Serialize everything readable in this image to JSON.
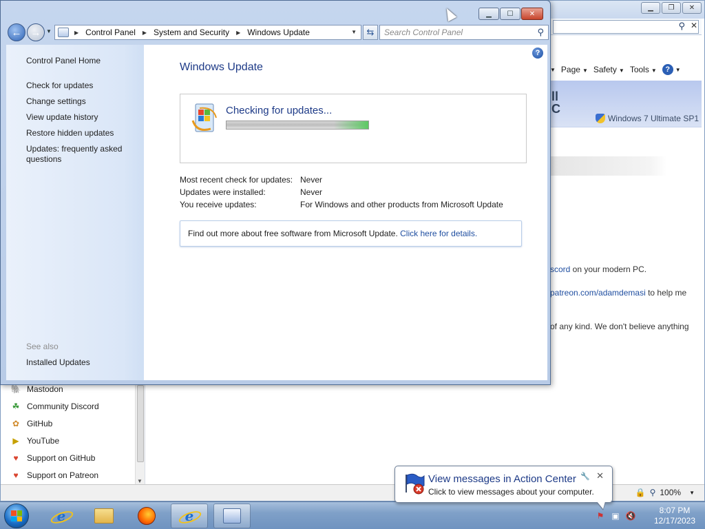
{
  "ie": {
    "page_menu": "Page",
    "safety_menu": "Safety",
    "tools_menu": "Tools",
    "banner_big": "ll\nC",
    "banner_edition": "Windows 7 Ultimate SP1",
    "line1_link": "scord",
    "line1_text": " on your modern PC.",
    "line2_link": "patreon.com/adamdemasi",
    "line2_text": " to help me",
    "line3_text": "of any kind. We don't believe anything",
    "sidebar_items": [
      {
        "label": "Mastodon",
        "icon": "mastodon-icon"
      },
      {
        "label": "Community Discord",
        "icon": "discord-icon"
      },
      {
        "label": "GitHub",
        "icon": "github-icon"
      },
      {
        "label": "YouTube",
        "icon": "youtube-icon"
      },
      {
        "label": "Support on GitHub",
        "icon": "heart-icon"
      },
      {
        "label": "Support on Patreon",
        "icon": "heart-icon"
      }
    ],
    "zoom": "100%"
  },
  "wu": {
    "breadcrumb": [
      "Control Panel",
      "System and Security",
      "Windows Update"
    ],
    "search_placeholder": "Search Control Panel",
    "left_links": {
      "home": "Control Panel Home",
      "check": "Check for updates",
      "change": "Change settings",
      "history": "View update history",
      "restore": "Restore hidden updates",
      "faq": "Updates: frequently asked questions",
      "see_also": "See also",
      "installed": "Installed Updates"
    },
    "title": "Windows Update",
    "status_text": "Checking for updates...",
    "progress": 1.0,
    "info": [
      {
        "label": "Most recent check for updates:",
        "value": "Never"
      },
      {
        "label": "Updates were installed:",
        "value": "Never"
      },
      {
        "label": "You receive updates:",
        "value": "For Windows and other products from Microsoft Update"
      }
    ],
    "find_text": "Find out more about free software from Microsoft Update. ",
    "find_link": "Click here for details."
  },
  "balloon": {
    "title": "View messages in Action Center",
    "message": "Click to view messages about your computer."
  },
  "taskbar": {
    "time": "8:07 PM",
    "date": "12/17/2023"
  },
  "colors": {
    "link": "#1f4ea0",
    "heading": "#1d3a87",
    "taskbar": "#7fa0c8"
  }
}
